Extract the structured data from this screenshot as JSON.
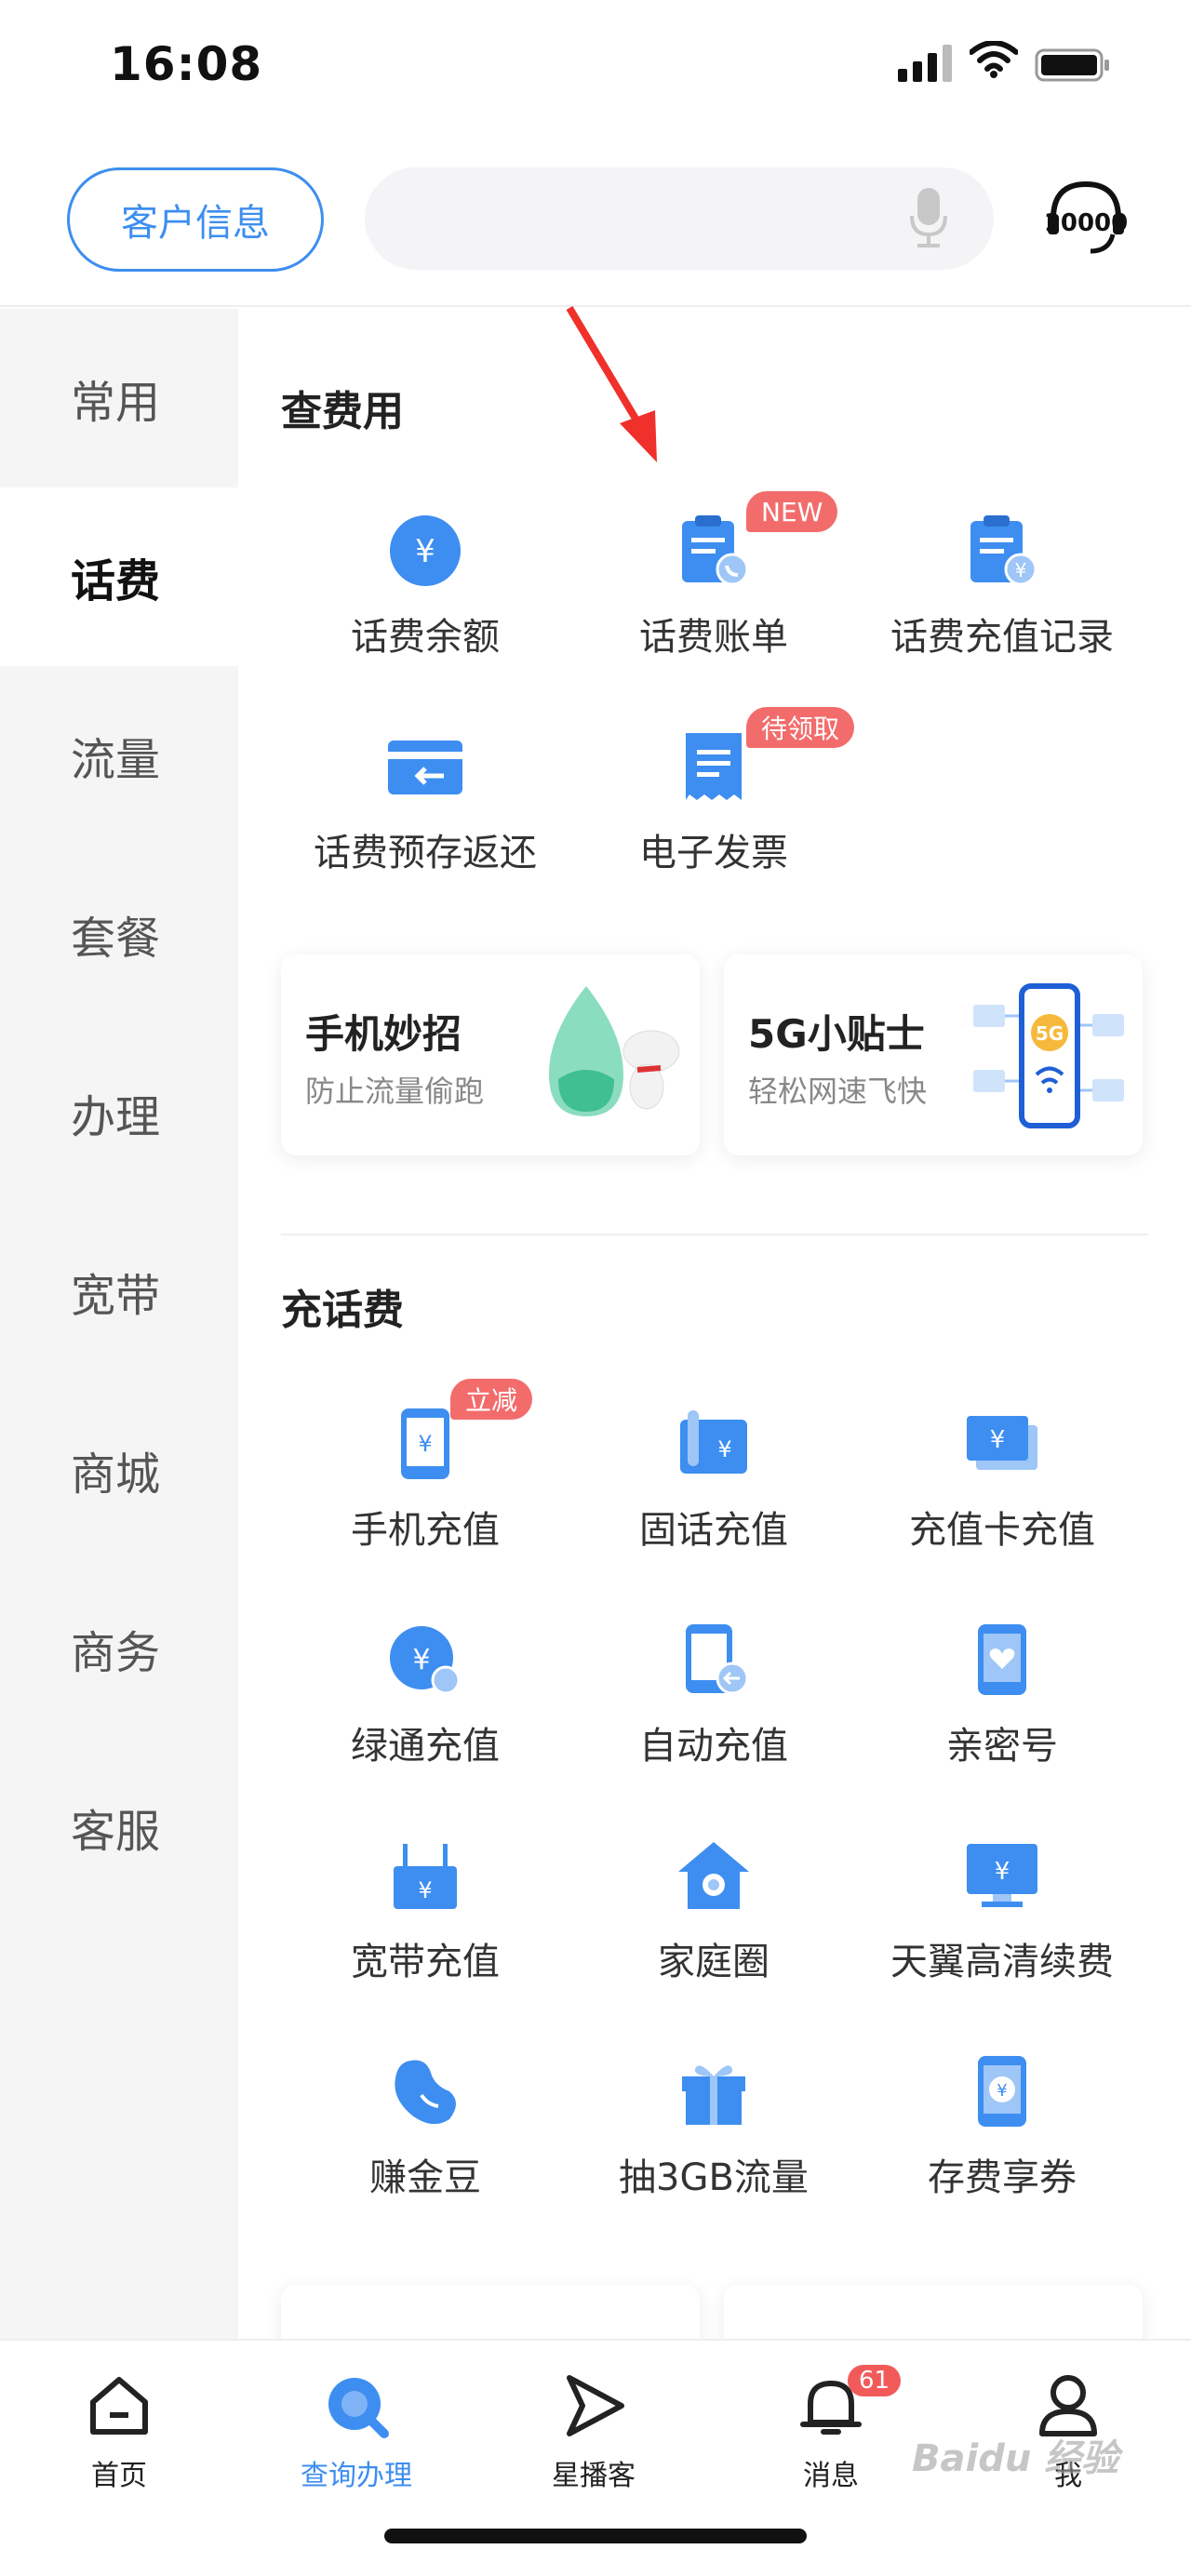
{
  "status_bar": {
    "time": "16:08"
  },
  "header": {
    "customer_info_label": "客户信息"
  },
  "sidebar": {
    "items": [
      {
        "label": "常用"
      },
      {
        "label": "话费"
      },
      {
        "label": "流量"
      },
      {
        "label": "套餐"
      },
      {
        "label": "办理"
      },
      {
        "label": "宽带"
      },
      {
        "label": "商城"
      },
      {
        "label": "商务"
      },
      {
        "label": "客服"
      }
    ],
    "active": "话费"
  },
  "section_query": {
    "title": "查费用",
    "items": [
      {
        "label": "话费余额",
        "icon": "yuan-circle-icon"
      },
      {
        "label": "话费账单",
        "icon": "bill-clipboard-icon",
        "badge": "NEW"
      },
      {
        "label": "话费充值记录",
        "icon": "recharge-record-icon"
      },
      {
        "label": "话费预存返还",
        "icon": "card-return-icon"
      },
      {
        "label": "电子发票",
        "icon": "invoice-icon",
        "badge": "待领取"
      }
    ]
  },
  "cards": [
    {
      "title": "手机妙招",
      "subtitle": "防止流量偷跑"
    },
    {
      "title": "5G小贴士",
      "subtitle": "轻松网速飞快",
      "art_text": "5G"
    }
  ],
  "section_recharge": {
    "title": "充话费",
    "items": [
      {
        "label": "手机充值",
        "icon": "phone-yuan-icon",
        "badge": "立减"
      },
      {
        "label": "固话充值",
        "icon": "landline-icon"
      },
      {
        "label": "充值卡充值",
        "icon": "recharge-card-icon"
      },
      {
        "label": "绿通充值",
        "icon": "green-channel-icon"
      },
      {
        "label": "自动充值",
        "icon": "auto-recharge-icon"
      },
      {
        "label": "亲密号",
        "icon": "heart-phone-icon"
      },
      {
        "label": "宽带充值",
        "icon": "router-icon"
      },
      {
        "label": "家庭圈",
        "icon": "home-icon"
      },
      {
        "label": "天翼高清续费",
        "icon": "tv-yuan-icon"
      },
      {
        "label": "赚金豆",
        "icon": "bean-icon"
      },
      {
        "label": "抽3GB流量",
        "icon": "gift-icon"
      },
      {
        "label": "存费享券",
        "icon": "phone-coupon-icon"
      }
    ]
  },
  "bottom_nav": {
    "items": [
      {
        "label": "首页",
        "icon": "home-nav-icon"
      },
      {
        "label": "查询办理",
        "icon": "search-nav-icon"
      },
      {
        "label": "星播客",
        "icon": "play-nav-icon"
      },
      {
        "label": "消息",
        "icon": "bell-nav-icon",
        "badge": "61"
      },
      {
        "label": "我",
        "icon": "profile-nav-icon"
      }
    ],
    "active": "查询办理"
  },
  "watermark": {
    "text": "Baidu 经验"
  },
  "colors": {
    "accent": "#3d8ef0",
    "badge": "#f26c6c",
    "sidebar_bg": "#f5f5f5"
  }
}
